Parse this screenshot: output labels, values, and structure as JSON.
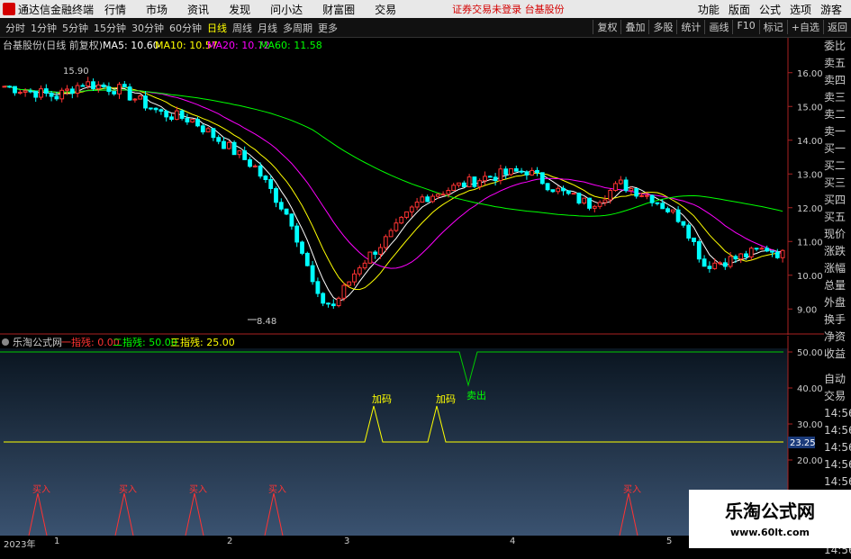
{
  "menubar": {
    "app_name": "通达信金融终端",
    "items": [
      "行情",
      "市场",
      "资讯",
      "发现",
      "问小达",
      "财富圈",
      "交易"
    ],
    "status": "证券交易未登录  台基股份",
    "right_items": [
      "功能",
      "版面",
      "公式",
      "选项",
      "游客"
    ]
  },
  "periodbar": {
    "periods": [
      "分时",
      "1分钟",
      "5分钟",
      "15分钟",
      "30分钟",
      "60分钟",
      "日线",
      "周线",
      "月线",
      "多周期",
      "更多"
    ],
    "active": "日线",
    "right_buttons": [
      "复权",
      "叠加",
      "多股",
      "统计",
      "画线",
      "F10",
      "标记",
      "+自选",
      "返回"
    ]
  },
  "main_chart": {
    "title": "台基股份(日线 前复权)",
    "ma_labels": [
      {
        "text": "MA5: 10.60",
        "color": "#ffffff"
      },
      {
        "text": "MA10: 10.57",
        "color": "#ffff00"
      },
      {
        "text": "MA20: 10.72",
        "color": "#ff00ff"
      },
      {
        "text": "MA60: 11.58",
        "color": "#00ff00"
      }
    ],
    "high_label": "15.90",
    "low_label": "8.48",
    "y_ticks": [
      "16.00",
      "15.00",
      "14.00",
      "13.00",
      "12.00",
      "11.00",
      "10.00",
      "9.00"
    ],
    "y_min": 8.5,
    "y_max": 16.5
  },
  "indicator": {
    "title": "乐淘公式网",
    "labels": [
      {
        "text": "一指残: 0.00",
        "color": "#ff3333"
      },
      {
        "text": "二指残: 50.00",
        "color": "#00ff00"
      },
      {
        "text": "三指残: 25.00",
        "color": "#ffff00"
      }
    ],
    "y_ticks": [
      "50.00",
      "40.00",
      "30.00",
      "20.00",
      "10.00"
    ],
    "current_value": "23.25",
    "signals": [
      {
        "text": "加码",
        "color": "#ffff00"
      },
      {
        "text": "加码",
        "color": "#ffff00"
      },
      {
        "text": "卖出",
        "color": "#00ff00"
      },
      {
        "text": "买入",
        "color": "#ff3333"
      },
      {
        "text": "买入",
        "color": "#ff3333"
      },
      {
        "text": "买入",
        "color": "#ff3333"
      },
      {
        "text": "买入",
        "color": "#ff3333"
      },
      {
        "text": "买入",
        "color": "#ff3333"
      }
    ]
  },
  "x_axis": [
    "2023年",
    "1",
    "2",
    "3",
    "4",
    "5"
  ],
  "side_panel": [
    "委比",
    "卖五",
    "卖四",
    "卖三",
    "卖二",
    "卖一",
    "买一",
    "买二",
    "买三",
    "买四",
    "买五",
    "现价",
    "涨跌",
    "涨幅",
    "总量",
    "外盘",
    "换手",
    "净资",
    "收益"
  ],
  "side_panel_lower": [
    "自动",
    "交易",
    "14:56",
    "14:56",
    "14:56",
    "14:56",
    "14:56",
    "14:56",
    "14:56",
    "14:56",
    "14:56"
  ],
  "watermark": {
    "line1": "乐淘公式网",
    "line2": "www.60lt.com"
  },
  "colors": {
    "up": "#ff3333",
    "down": "#00ffff",
    "ma5": "#ffffff",
    "ma10": "#ffff00",
    "ma20": "#ff00ff",
    "ma60": "#00ff00"
  }
}
